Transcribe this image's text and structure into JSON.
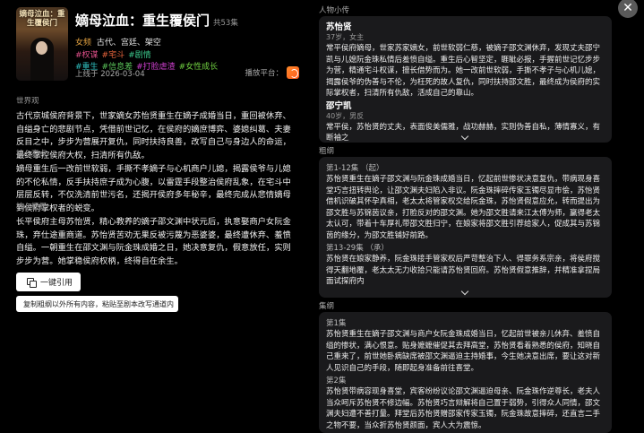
{
  "drama": {
    "cover_text": "嫡母泣血：重生覆侯门",
    "title": "嫡母泣血：重生覆侯门",
    "episode_count": "共53集",
    "genre_label": "女频",
    "genres": "古代、宫廷、架空",
    "tags_row1": [
      {
        "text": "#权谋",
        "color": "#e0508a"
      },
      {
        "text": "#宅斗",
        "color": "#e8643c"
      },
      {
        "text": "#剧情",
        "color": "#3cc88c"
      }
    ],
    "tags_row2": [
      {
        "text": "#重生",
        "color": "#30c0c0"
      },
      {
        "text": "#信息差",
        "color": "#5cc85c"
      },
      {
        "text": "#打脸虐渣",
        "color": "#d040d0"
      },
      {
        "text": "#女性成长",
        "color": "#70d040"
      }
    ],
    "release": "上线于 2026-03-04",
    "platform_label": "播放平台："
  },
  "sections": {
    "world": {
      "title": "世界观",
      "text": "古代京城侯府背景下，世家嫡女苏怡贤重生在嫡子成婚当日，重回被休弃、自缢身亡的悲剧节点，凭借前世记忆，在侯府的嫡庶博弈、婆媳纠葛、夫妻反目之中，步步为营展开复仇，同时扶持良善，改写自己与身边人的命运，最终掌控侯府大权，扫清所有仇敌。"
    },
    "highlight": {
      "title": "核心亮点",
      "text": "嫡母重生后一改前世软弱，手撕不孝嫡子与心机商户儿媳，揭露侯爷与儿媳的不伦私情，反手扶持庶子成为心腹，以雷霆手段整治侯府乱象，在宅斗中层层反转，不仅洗清前世污名，还揭开侯府多年秘辛，最终完成从悲情嫡母到侯府掌权者的蜕变。"
    },
    "summary": {
      "title": "核心梗概",
      "text": "长平侯府主母苏怡贤，精心教养的嫡子邵文渊中状元后，执意娶商户女阮金珠，弃仕途重商道。苏怡贤苦劝无果反被污蔑为恶婆婆，最终遭休弃、羞愤自缢。一朝重生在邵文渊与阮金珠成婚之日，她决意复仇，假意放任，实则步步为营。她掌稳侯府权柄，终得自在余生。"
    }
  },
  "buttons": {
    "quote": "一键引用",
    "copy_hint": "复制粗纲以外所有内容，粘贴至剧本改写通道内"
  },
  "characters": {
    "title": "人物小传",
    "items": [
      {
        "name": "苏怡贤",
        "meta": "37岁，女主",
        "bio": "常平侯府嫡母，世家苏家嫡女，前世软弱仁慈，被嫡子邵文渊休弃，发现丈夫邵宁凯与儿媳阮金珠私情后羞愤自缢。重生后心智坚定，睚眦必报，手握前世记忆步步为营，精通宅斗权谋，擅长借势而为。她一改前世软弱，手撕不孝子与心机儿媳，揭露侯爷的伪善与不伦，为枉死的故人复仇，同时扶持邵文胜，最终成为侯府的实际掌权者，扫清所有仇敌，活成自己的靠山。"
      },
      {
        "name": "邵宁凯",
        "meta": "40岁，男反",
        "bio": "常平侯，苏怡贤的丈夫，表面俊美儒雅，战功赫赫，实则伪善自私，薄情寡义，有断袖之"
      }
    ]
  },
  "outline": {
    "title": "粗纲",
    "items": [
      {
        "ep": "第1-12集 （起）",
        "text": "苏怡贤重生在嫡子邵文渊与阮金珠成婚当日，忆起前世惨状决意复仇，带病现身喜堂巧言扭转舆论，让邵文渊夫妇陷入非议。阮金珠摔碎传家玉镯尽显市侩，苏怡贤借机识破其怀孕真相，老太太将管家权交给阮金珠，苏怡贤假意应允，转而提出为邵文胜与苏锦茵议亲，打脸反对的邵文渊。她为邵文胜请来江太傅为师，赢得老太太认可，带着十车厚礼带邵文胜归宁，在娘家将邵文胜引荐给家人，促成其与苏锦茵的缘分，为邵文胜铺好前路。"
      },
      {
        "ep": "第13-29集 （承）",
        "text": "苏怡贤在娘家静养，阮金珠接手管家权后严苛整治下人、得罪务系宗亲，将侯府搅得天翻地覆，老太太无力收拾只能请苏怡贤回府。苏怡贤假意推辞，并精准拿捏局面试探府内"
      }
    ]
  },
  "episodes": {
    "title": "集纲",
    "items": [
      {
        "ep": "第1集",
        "text": "苏怡贤重生在嫡子邵文渊与商户女阮金珠成婚当日，忆起前世被亲儿休弃、羞愤自缢的惨状，满心恨意。贴身嬷嬷催促其去拜高堂，苏怡贤看着熟悉的侯府，知晓自己重来了，前世她卧病缺席被邵文渊逼迫主持婚事，今生她决意出席，要让这对新人见识自己的手段，随即起身准备前往喜堂。"
      },
      {
        "ep": "第2集",
        "text": "苏怡贤带病容现身喜堂，宾客纷纷议论邵文渊逼迫母亲、阮金珠作逆尊长，老夫人当众呵斥苏怡贤不修边幅。苏怡贤巧言辩解将自己置于弱势，引得众人同情，邵文渊夫妇遭不善打量。拜堂后苏怡贤赠邵家传家玉镯，阮金珠故意摔碎，还直言二手之物不要，当众折苏怡贤颜面，宾人大为震惊。"
      }
    ]
  }
}
